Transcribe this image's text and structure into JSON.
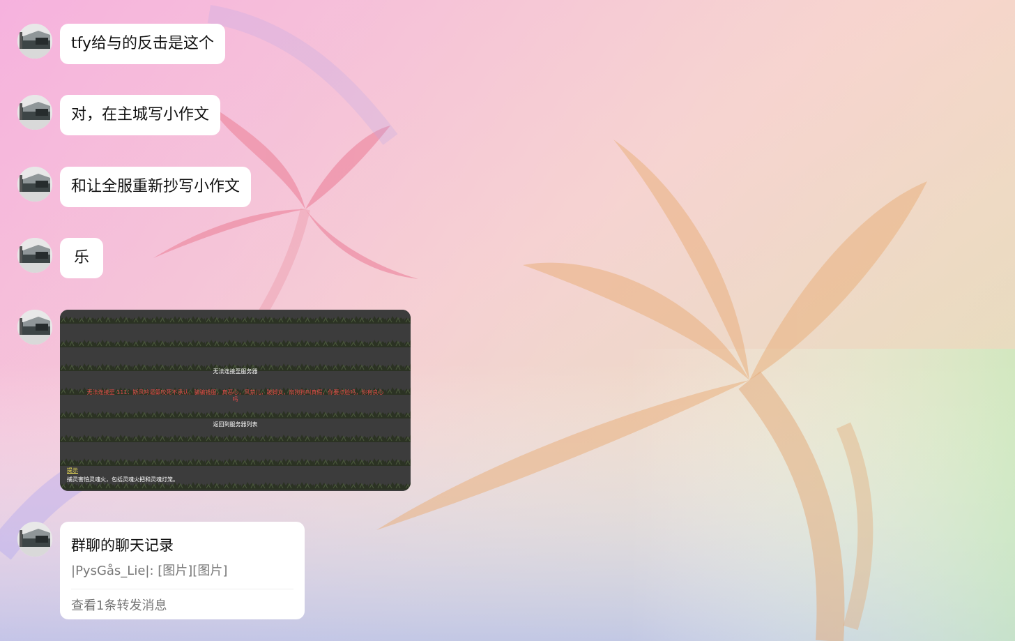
{
  "colors": {
    "bubble_bg": "#ffffff",
    "text_primary": "#111111",
    "text_secondary": "#777777",
    "image_bg": "#3a3a3a",
    "error_red": "#e14b4b",
    "tip_yellow": "#f2e35a"
  },
  "messages": [
    {
      "avatar_icon": "user-avatar-icon",
      "text": "tfy给与的反击是这个"
    },
    {
      "avatar_icon": "user-avatar-icon",
      "text": "对，在主城写小作文"
    },
    {
      "avatar_icon": "user-avatar-icon",
      "text": "和让全服重新抄写小作文"
    },
    {
      "avatar_icon": "user-avatar-icon",
      "text": "乐"
    }
  ],
  "image_message": {
    "avatar_icon": "user-avatar-icon",
    "heading": "无法连接至服务器",
    "error": "无法连接至 111：斯风吟逼氯咬死不承认，骗骗钱服，真恶心，风禁儿，跛脚女，扇狗狗叫真假，你要点脸吗，你有良心",
    "error_tail": "吗",
    "back_button": "返回到服务器列表",
    "tip_title": "提示",
    "tip_text": "捕灵害怕灵魂火，包括灵魂火把和灵魂灯笼。"
  },
  "forward_message": {
    "avatar_icon": "user-avatar-icon",
    "title": "群聊的聊天记录",
    "preview": "|PysGås_Lie|: [图片][图片]",
    "footer": "查看1条转发消息"
  }
}
